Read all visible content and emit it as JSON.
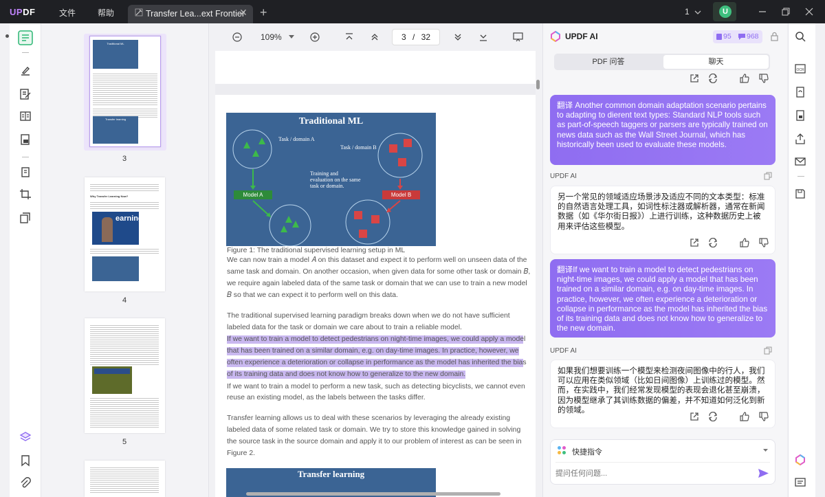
{
  "titlebar": {
    "logo_up": "UP",
    "logo_df": "DF",
    "menu_file": "文件",
    "menu_help": "帮助",
    "tab_title": "Transfer Lea...ext Frontier",
    "tab_close": "✕",
    "new_tab": "+",
    "window_count": "1",
    "avatar_letter": "U"
  },
  "thumbnails": {
    "pages": [
      {
        "number": "3",
        "selected": true
      },
      {
        "number": "4",
        "selected": false
      },
      {
        "number": "5",
        "selected": false
      }
    ],
    "page3_heading": "Traditional ML",
    "page3_sub": "Transfer learning",
    "page4_heading": "Why Transfer Learning Now?",
    "page4_video_text": "earning"
  },
  "toolbar": {
    "zoom": "109%",
    "current_page": "3",
    "page_sep": "/",
    "total_pages": "32"
  },
  "document": {
    "figure1_title": "Traditional ML",
    "fig_task_a": "Task / domain A",
    "fig_task_b": "Task / domain B",
    "fig_training": [
      "Training and",
      "evaluation on the same",
      "task or domain."
    ],
    "fig_model_a": "Model A",
    "fig_model_b": "Model B",
    "caption": "Figure 1: The traditional supervised learning setup in ML",
    "para1": [
      "We can now train a model 𝐴 on this dataset and expect it to perform well on unseen data of the",
      "same task and domain. On another occasion, when given data for some other task or domain 𝐵,",
      "we require again labeled data of the same task or domain that we can use to train a new model",
      "𝐵 so that we can expect it to perform well on this data."
    ],
    "para2": [
      "The traditional supervised learning paradigm breaks down when we do not have sufficient",
      "labeled data for the task or domain we care about to train a reliable model."
    ],
    "para_highlight": [
      "If we want to train a model to detect pedestrians on night-time images, we could apply a model",
      "that has been trained on a similar domain, e.g. on day-time images. In practice, however, we",
      "often experience a deterioration or collapse in performance as the model has inherited the bias",
      "of its training data and does not know how to generalize to the new domain."
    ],
    "para3": [
      "If we want to train a model to perform a new task, such as detecting bicyclists, we cannot even",
      "reuse an existing model, as the labels between the tasks differ."
    ],
    "para4": [
      "Transfer learning allows us to deal with these scenarios by leveraging the already existing",
      "labeled data of some related task or domain. We try to store this knowledge gained in solving",
      "the source task in the source domain and apply it to our problem of interest as can be seen in",
      "Figure 2."
    ],
    "figure2_title": "Transfer learning"
  },
  "ai": {
    "title": "UPDF AI",
    "credits_pdf": "95",
    "credits_chat": "968",
    "tab_pdf": "PDF 问答",
    "tab_chat": "聊天",
    "messages": [
      {
        "role": "user",
        "text": "翻译 Another common domain adaptation scenario pertains to adapting to dierent text types: Standard NLP tools such as part-of-speech taggers or parsers are typically trained on news data such as the Wall Street Journal, which has historically been used to evaluate these models."
      },
      {
        "role": "ai",
        "sender": "UPDF AI",
        "text": "另一个常见的领域适应场景涉及适应不同的文本类型：标准的自然语言处理工具，如词性标注器或解析器，通常在新闻数据（如《华尔街日报》）上进行训练，这种数据历史上被用来评估这些模型。"
      },
      {
        "role": "user",
        "text": "翻译If we want to train a model to detect pedestrians on night-time images, we could apply a model that has been trained on a similar domain, e.g. on day-time images. In practice, however, we often experience a deterioration or collapse in performance as the model has inherited the bias of its training data and does not know how to generalize to the new domain."
      },
      {
        "role": "ai",
        "sender": "UPDF AI",
        "text": "如果我们想要训练一个模型来检测夜间图像中的行人，我们可以应用在类似领域（比如日间图像）上训练过的模型。然而，在实践中，我们经常发现模型的表现会退化甚至崩溃，因为模型继承了其训练数据的偏差，并不知道如何泛化到新的领域。"
      }
    ],
    "quick_command": "快捷指令",
    "input_placeholder": "提问任何问题..."
  },
  "colors": {
    "accent": "#8f6df1",
    "titlebar": "#1f2024",
    "figure_bg": "#3b6494"
  }
}
